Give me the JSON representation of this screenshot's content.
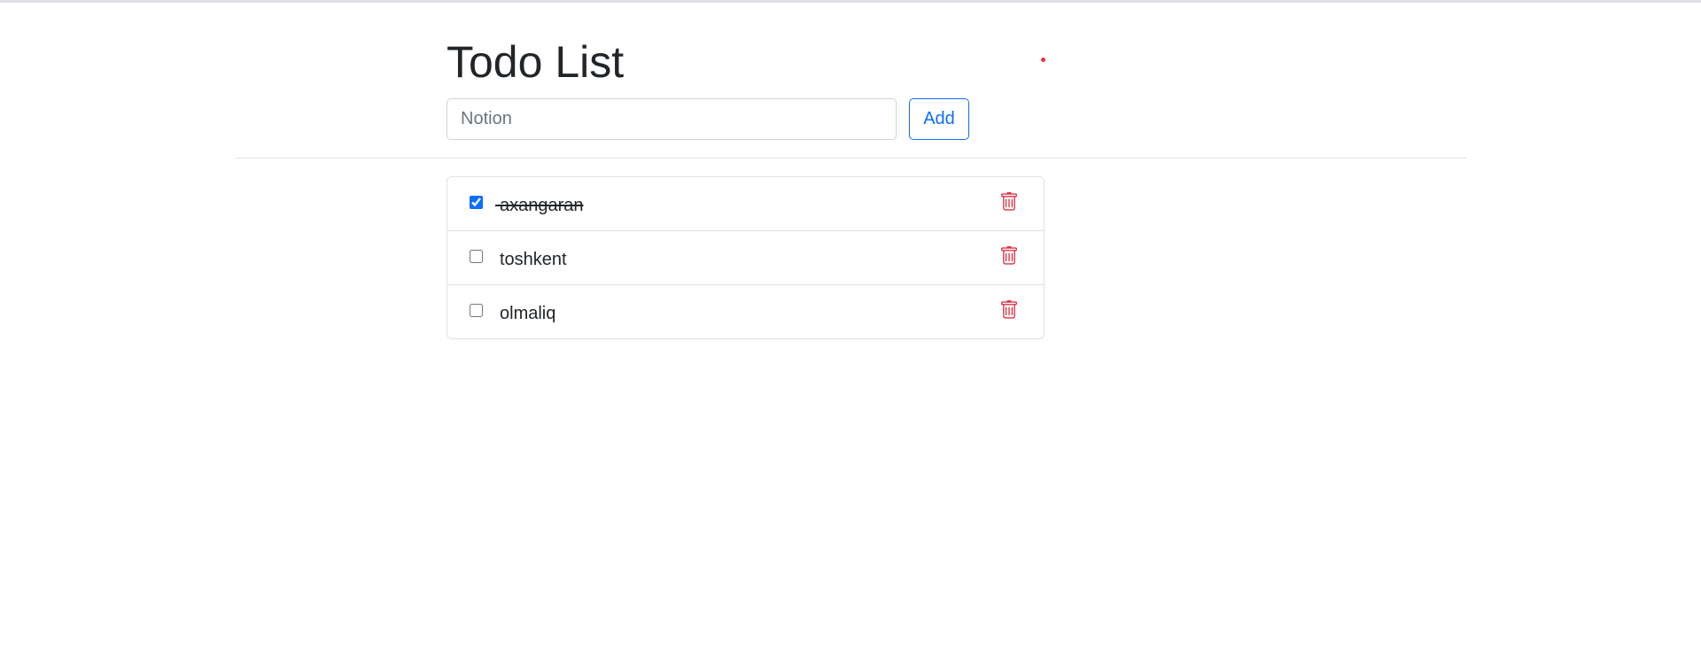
{
  "page": {
    "title": "Todo List"
  },
  "form": {
    "input_placeholder": "Notion",
    "input_value": "",
    "add_label": "Add"
  },
  "todos": [
    {
      "text": "axangaran",
      "done": true
    },
    {
      "text": "toshkent",
      "done": false
    },
    {
      "text": "olmaliq",
      "done": false
    }
  ],
  "icons": {
    "delete": "trash-icon"
  },
  "colors": {
    "primary": "#0d6efd",
    "danger": "#dc3545",
    "text": "#212529",
    "border": "#dee2e6"
  }
}
